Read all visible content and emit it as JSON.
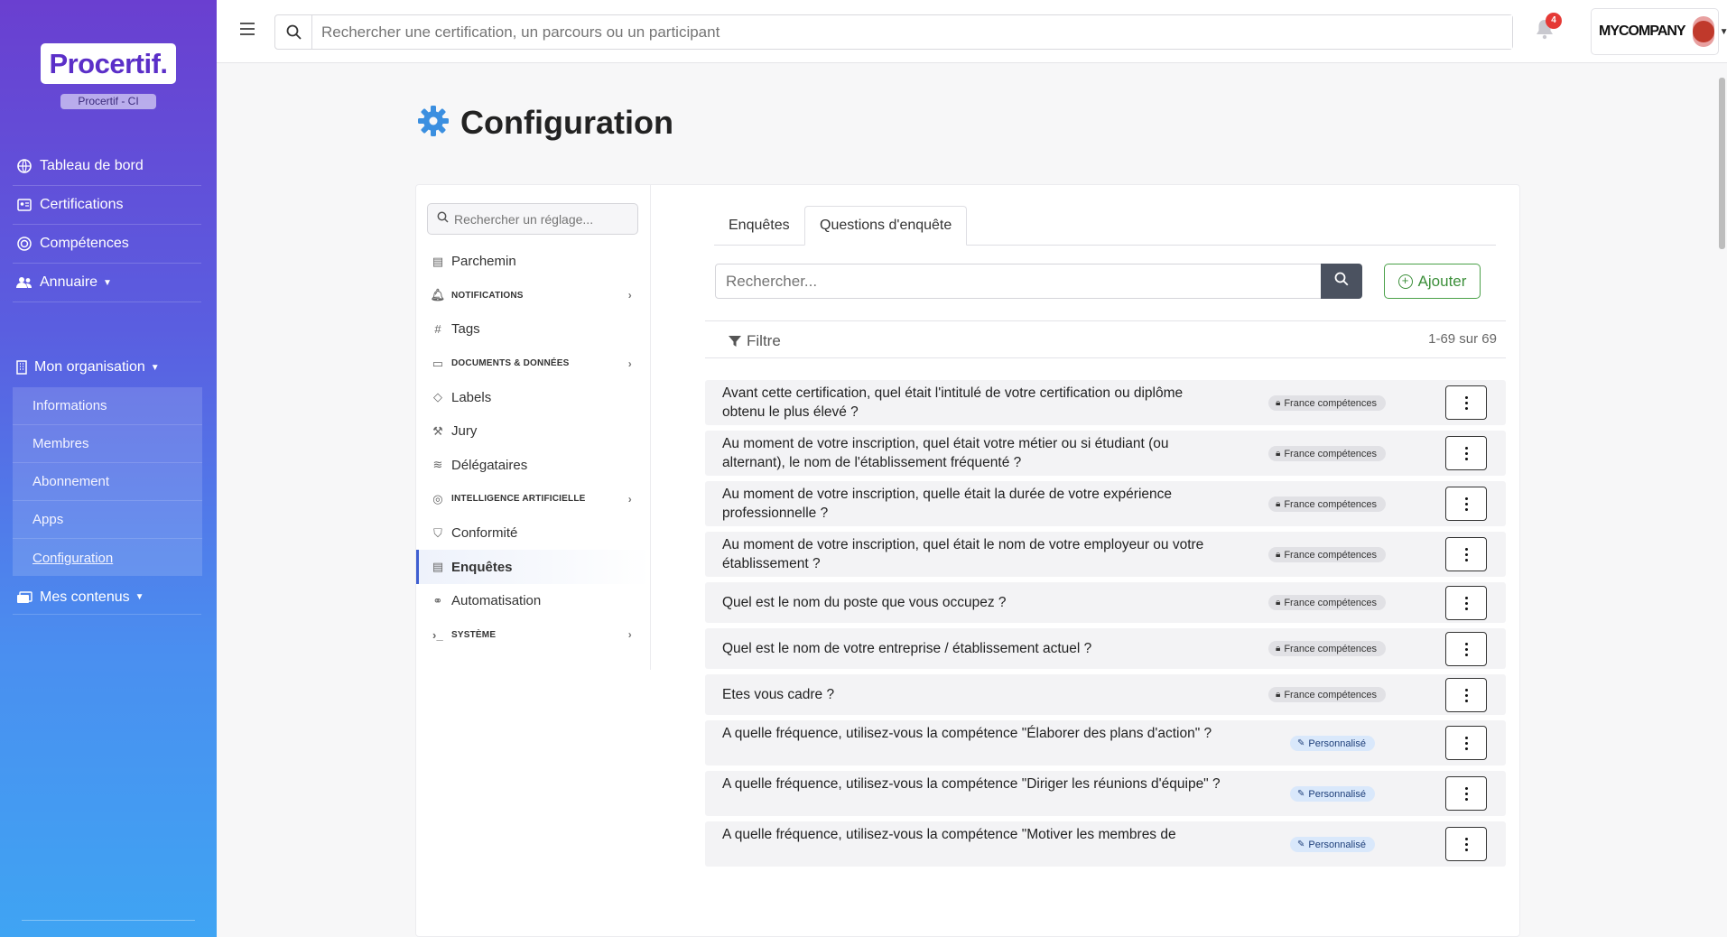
{
  "brand": {
    "logo": "Procertif.",
    "org_badge": "Procertif - CI"
  },
  "sidebar": {
    "items": [
      {
        "label": "Tableau de bord",
        "icon": "globe-icon"
      },
      {
        "label": "Certifications",
        "icon": "id-card-icon"
      },
      {
        "label": "Compétences",
        "icon": "target-icon"
      },
      {
        "label": "Annuaire",
        "icon": "users-icon"
      }
    ],
    "org": {
      "label": "Mon organisation"
    },
    "org_items": [
      "Informations",
      "Membres",
      "Abonnement",
      "Apps",
      "Configuration"
    ],
    "contents": {
      "label": "Mes contenus"
    }
  },
  "topbar": {
    "search_placeholder": "Rechercher une certification, un parcours ou un participant",
    "notifications_count": "4",
    "company_name": "MYCOMPANY"
  },
  "page": {
    "title": "Configuration"
  },
  "settings": {
    "search_placeholder": "Rechercher un réglage...",
    "items": [
      {
        "label": "Parchemin",
        "icon": "scroll-icon",
        "group": false
      },
      {
        "label": "NOTIFICATIONS",
        "icon": "bell-icon",
        "group": true
      },
      {
        "label": "Tags",
        "icon": "hash-icon",
        "group": false
      },
      {
        "label": "DOCUMENTS & DONNÉES",
        "icon": "folder-icon",
        "group": true
      },
      {
        "label": "Labels",
        "icon": "label-icon",
        "group": false
      },
      {
        "label": "Jury",
        "icon": "gavel-icon",
        "group": false
      },
      {
        "label": "Délégataires",
        "icon": "handshake-icon",
        "group": false
      },
      {
        "label": "INTELLIGENCE ARTIFICIELLE",
        "icon": "robot-icon",
        "group": true
      },
      {
        "label": "Conformité",
        "icon": "shield-icon",
        "group": false
      },
      {
        "label": "Enquêtes",
        "icon": "survey-icon",
        "group": false,
        "active": true
      },
      {
        "label": "Automatisation",
        "icon": "nodes-icon",
        "group": false
      },
      {
        "label": "SYSTÈME",
        "icon": "terminal-icon",
        "group": true
      }
    ]
  },
  "tabs": [
    {
      "label": "Enquêtes",
      "active": false
    },
    {
      "label": "Questions d'enquête",
      "active": true
    }
  ],
  "questions_panel": {
    "search_placeholder": "Rechercher...",
    "add_label": "Ajouter",
    "filter_label": "Filtre",
    "range_label": "1-69 sur 69"
  },
  "questions": [
    {
      "text": "Avant cette certification, quel était l'intitulé de votre certification ou diplôme obtenu le plus élevé ?",
      "badge": "France compétences",
      "type": "fc"
    },
    {
      "text": "Au moment de votre inscription, quel était votre métier ou si étudiant (ou alternant), le nom de l'établissement fréquenté ?",
      "badge": "France compétences",
      "type": "fc"
    },
    {
      "text": "Au moment de votre inscription, quelle était la durée de votre expérience professionnelle ?",
      "badge": "France compétences",
      "type": "fc"
    },
    {
      "text": "Au moment de votre inscription, quel était le nom de votre employeur ou votre établissement ?",
      "badge": "France compétences",
      "type": "fc"
    },
    {
      "text": "Quel est le nom du poste que vous occupez ?",
      "badge": "France compétences",
      "type": "fc"
    },
    {
      "text": "Quel est le nom de votre entreprise / établissement actuel ?",
      "badge": "France compétences",
      "type": "fc"
    },
    {
      "text": "Etes vous cadre ?",
      "badge": "France compétences",
      "type": "fc"
    },
    {
      "text": "A quelle fréquence, utilisez-vous la compétence \"Élaborer des plans d'action\" ?",
      "badge": "Personnalisé",
      "type": "perso"
    },
    {
      "text": "A quelle fréquence, utilisez-vous la compétence \"Diriger les réunions d'équipe\" ?",
      "badge": "Personnalisé",
      "type": "perso"
    },
    {
      "text": "A quelle fréquence, utilisez-vous la compétence \"Motiver les membres de",
      "badge": "Personnalisé",
      "type": "perso"
    }
  ],
  "colors": {
    "accent": "#3f5fd1",
    "add_green": "#3c8f3a",
    "notif_red": "#e53935"
  }
}
